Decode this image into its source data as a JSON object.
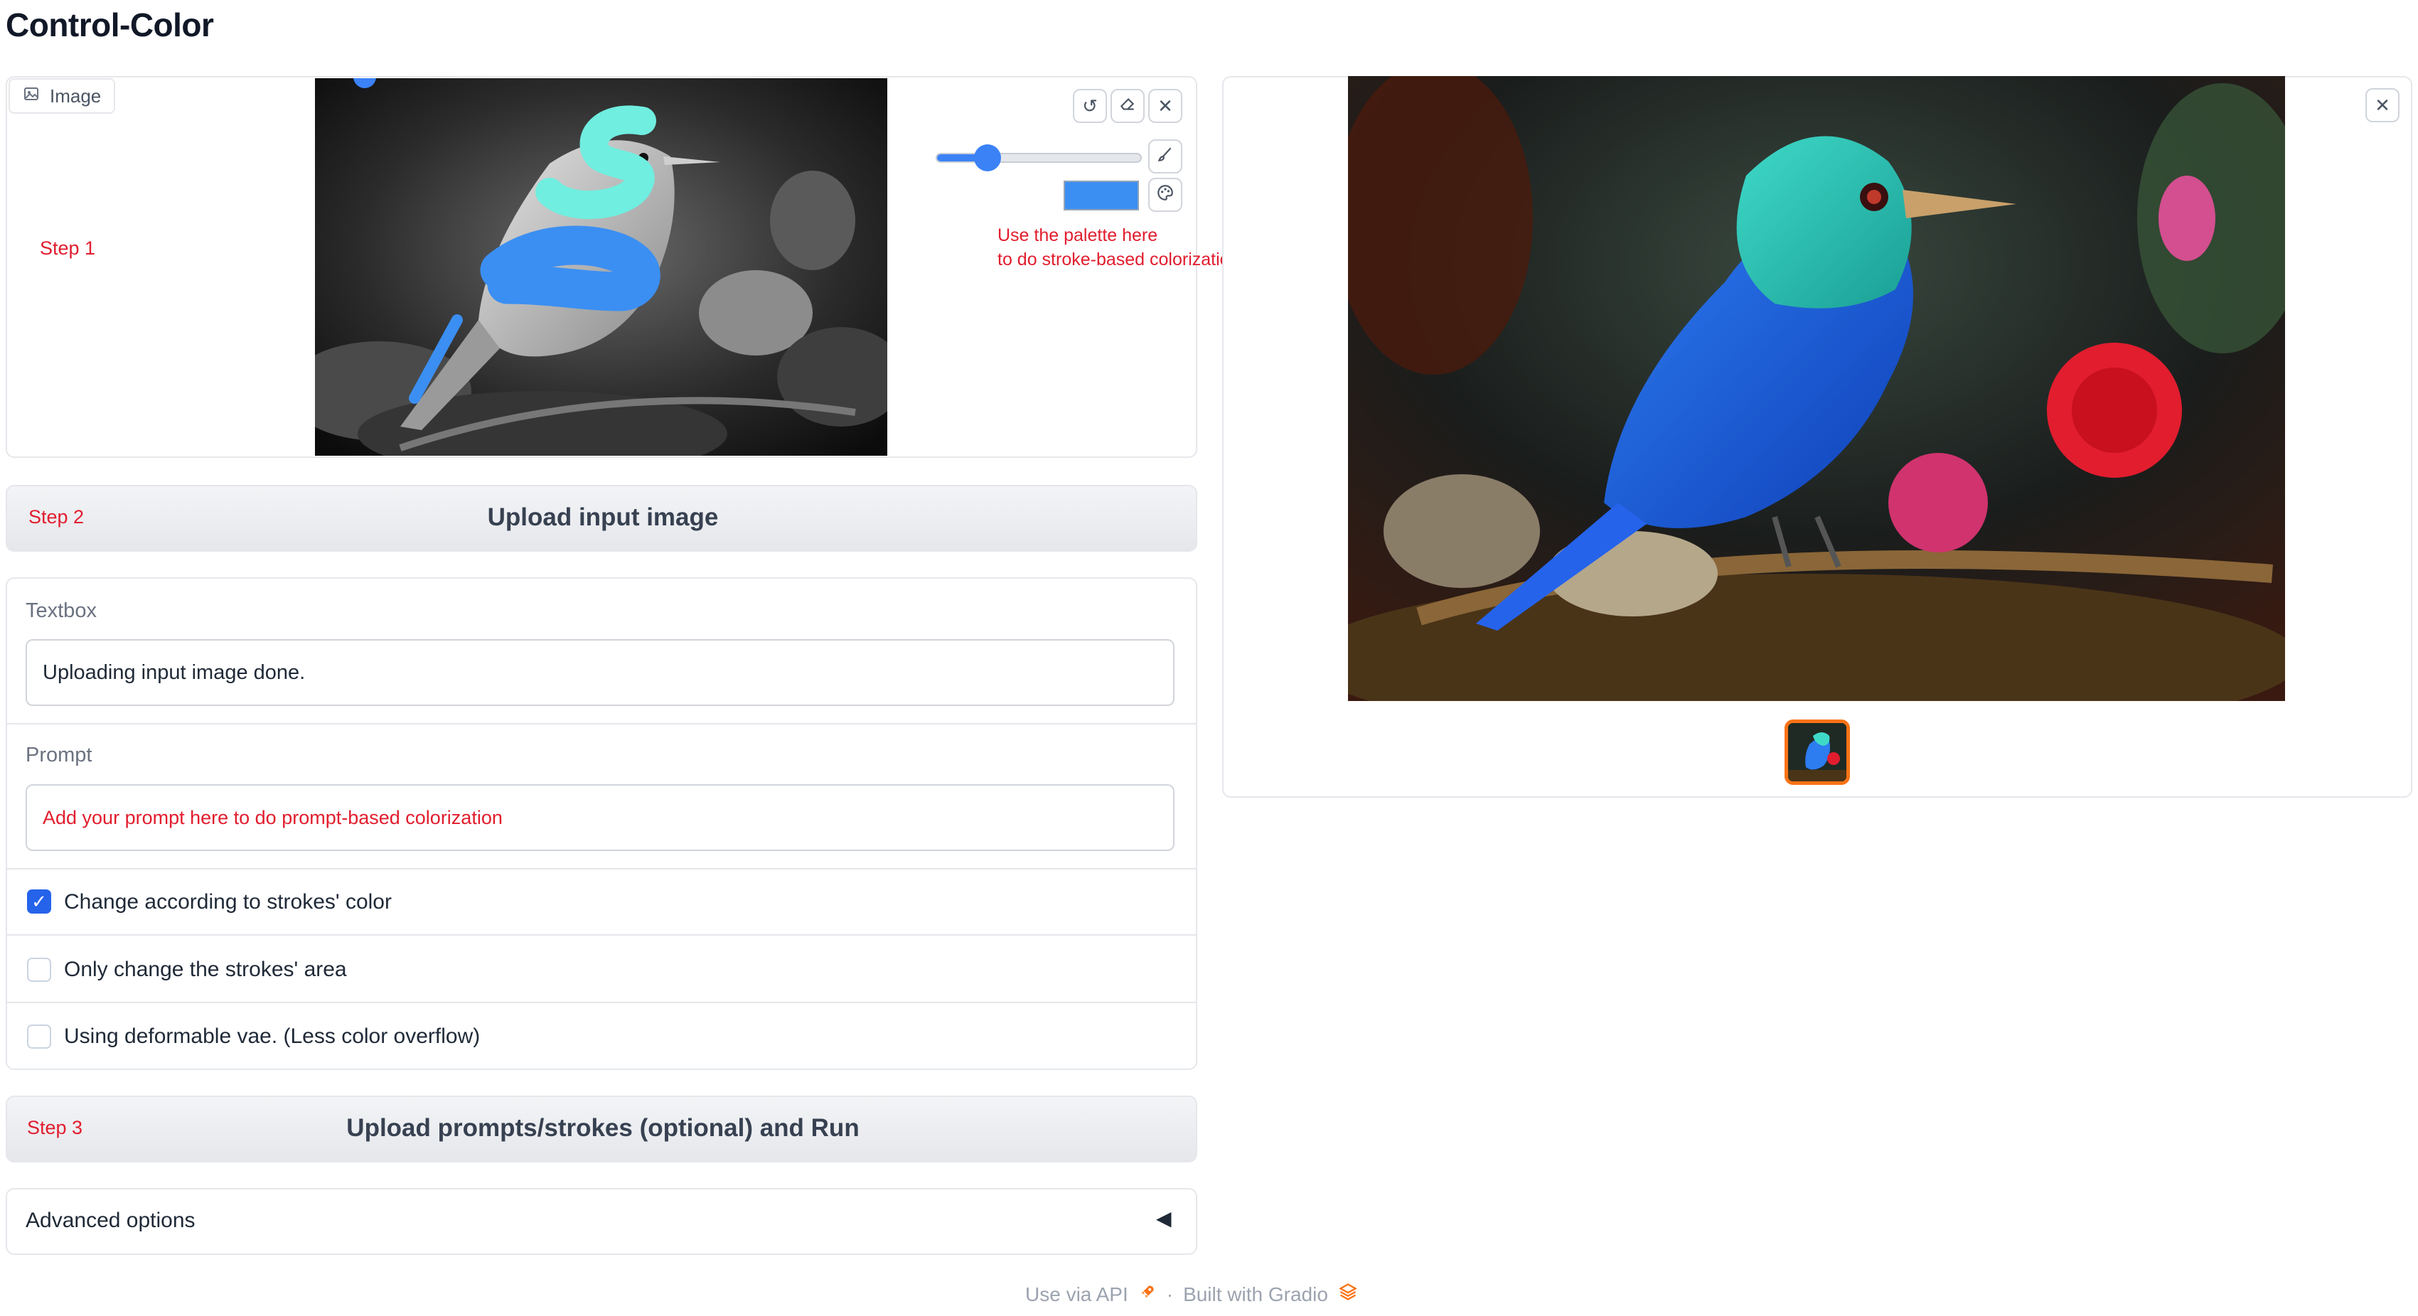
{
  "app": {
    "title": "Control-Color"
  },
  "step1": {
    "label": "Step 1",
    "image_chip_label": "Image",
    "hint_line1": "Use the palette here",
    "hint_line2": "to do stroke-based colorization",
    "brush_size_fraction": 0.25,
    "brush_color": "#3b8ff2"
  },
  "step2": {
    "label": "Step 2",
    "button_label": "Upload input image"
  },
  "textbox": {
    "label": "Textbox",
    "value": "Uploading input image done."
  },
  "prompt": {
    "label": "Prompt",
    "placeholder": "Add your prompt here to do prompt-based colorization"
  },
  "options": {
    "strokes_color": {
      "label": "Change according to strokes' color",
      "checked": true
    },
    "strokes_area": {
      "label": "Only change the strokes' area",
      "checked": false
    },
    "deformable_vae": {
      "label": "Using deformable vae. (Less color overflow)",
      "checked": false
    }
  },
  "step3": {
    "label": "Step 3",
    "button_label": "Upload prompts/strokes (optional) and Run"
  },
  "advanced": {
    "label": "Advanced options"
  },
  "footer": {
    "api": "Use via API",
    "separator": "·",
    "built": "Built with Gradio"
  },
  "icons": {
    "image": "image-icon",
    "undo": "undo-icon",
    "eraser": "eraser-icon",
    "clear": "close-icon",
    "brush": "brush-icon",
    "palette": "palette-icon",
    "collapse": "triangle-left-icon",
    "rocket": "rocket-icon",
    "gradio": "gradio-logo-icon"
  },
  "colors": {
    "accent": "#3b82f6",
    "hint_red": "#e11d2e",
    "checkbox_blue": "#2563eb",
    "thumb_border": "#f97316"
  }
}
